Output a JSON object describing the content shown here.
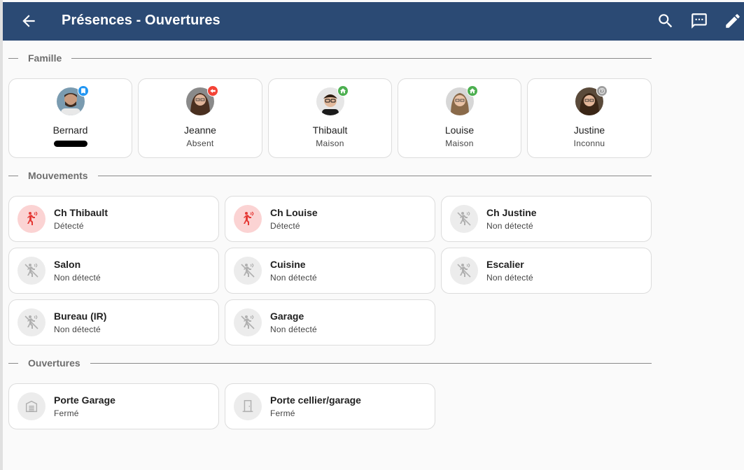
{
  "header": {
    "title": "Présences - Ouvertures",
    "background": "#2b4a74",
    "icons": [
      "back-arrow-icon",
      "search-icon",
      "chat-icon",
      "edit-icon"
    ]
  },
  "famille": {
    "title": "Famille",
    "people": [
      {
        "name": "Bernard",
        "state": "",
        "badge_color": "#2196f3",
        "badge_icon": "bookmark-icon"
      },
      {
        "name": "Jeanne",
        "state": "Absent",
        "badge_color": "#f44336",
        "badge_icon": "away-icon"
      },
      {
        "name": "Thibault",
        "state": "Maison",
        "badge_color": "#4caf50",
        "badge_icon": "home-icon"
      },
      {
        "name": "Louise",
        "state": "Maison",
        "badge_color": "#4caf50",
        "badge_icon": "home-icon"
      },
      {
        "name": "Justine",
        "state": "Inconnu",
        "badge_color": "#9e9e9e",
        "badge_icon": "question-icon"
      }
    ]
  },
  "mouvements": {
    "title": "Mouvements",
    "sensors": [
      {
        "name": "Ch Thibault",
        "state": "Détecté",
        "active": true
      },
      {
        "name": "Ch Louise",
        "state": "Détecté",
        "active": true
      },
      {
        "name": "Ch Justine",
        "state": "Non détecté",
        "active": false
      },
      {
        "name": "Salon",
        "state": "Non détecté",
        "active": false
      },
      {
        "name": "Cuisine",
        "state": "Non détecté",
        "active": false
      },
      {
        "name": "Escalier",
        "state": "Non détecté",
        "active": false
      },
      {
        "name": "Bureau (IR)",
        "state": "Non détecté",
        "active": false
      },
      {
        "name": "Garage",
        "state": "Non détecté",
        "active": false
      }
    ]
  },
  "ouvertures": {
    "title": "Ouvertures",
    "doors": [
      {
        "name": "Porte Garage",
        "state": "Fermé",
        "icon": "garage-icon"
      },
      {
        "name": "Porte cellier/garage",
        "state": "Fermé",
        "icon": "door-icon"
      }
    ]
  },
  "colors": {
    "active_bg": "#fbd3d3",
    "active_fg": "#e53935",
    "inactive_bg": "#ececec",
    "inactive_fg": "#b0b0b0"
  }
}
